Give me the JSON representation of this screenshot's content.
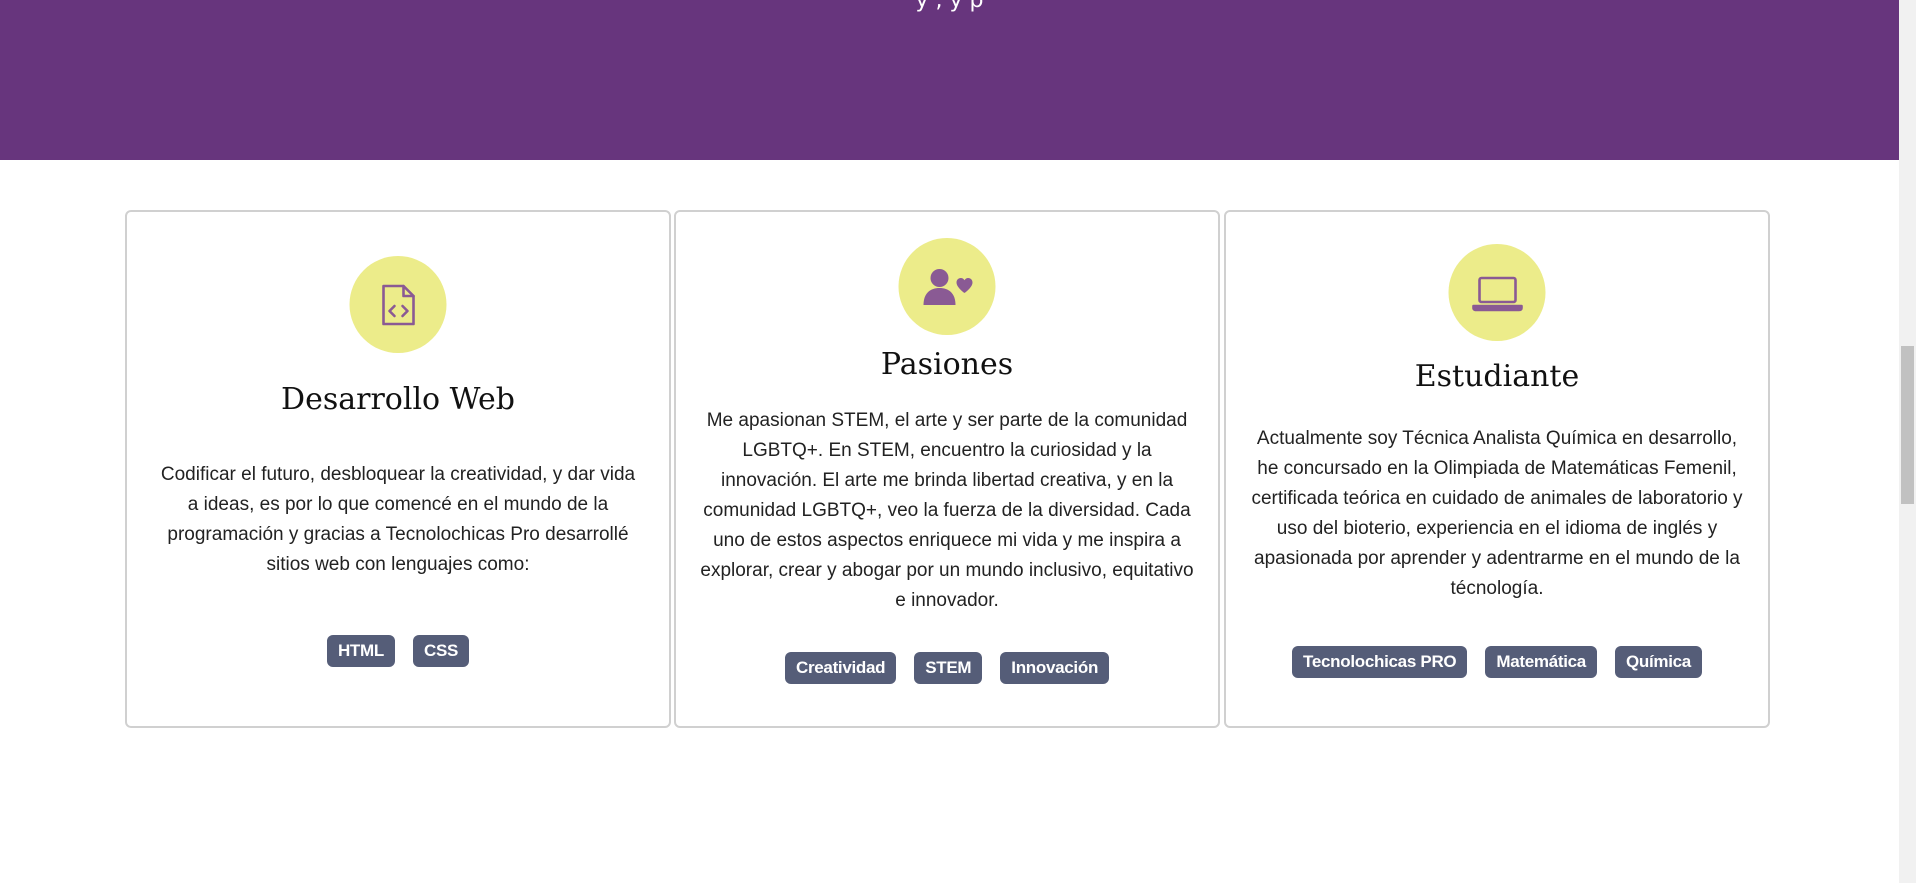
{
  "hero": {
    "partial_text": "y              ,     y         p"
  },
  "cards": [
    {
      "icon": "file-code-icon",
      "title": "Desarrollo Web",
      "text": "Codificar el futuro, desbloquear la creatividad, y dar vida a ideas, es por lo que comencé en el mundo de la programación y gracias a Tecnolochicas Pro desarrollé sitios web con lenguajes como:",
      "tags": [
        "HTML",
        "CSS"
      ]
    },
    {
      "icon": "user-heart-icon",
      "title": "Pasiones",
      "text": "Me apasionan STEM, el arte y ser parte de la comunidad LGBTQ+. En STEM, encuentro la curiosidad y la innovación. El arte me brinda libertad creativa, y en la comunidad LGBTQ+, veo la fuerza de la diversidad. Cada uno de estos aspectos enriquece mi vida y me inspira a explorar, crear y abogar por un mundo inclusivo, equitativo e innovador.",
      "tags": [
        "Creatividad",
        "STEM",
        "Innovación"
      ]
    },
    {
      "icon": "laptop-icon",
      "title": "Estudiante",
      "text": "Actualmente soy Técnica Analista Química en desarrollo, he concursado en la Olimpiada de Matemáticas Femenil, certificada teórica en cuidado de animales de laboratorio y uso del bioterio, experiencia en el idioma de inglés y apasionada por aprender y adentrarme en el mundo de la técnología.",
      "tags": [
        "Tecnolochicas PRO",
        "Matemática",
        "Química"
      ]
    }
  ],
  "colors": {
    "hero": "#67357d",
    "icon_circle": "#ecec8a",
    "icon_stroke": "#8a5a94",
    "tag": "#555d78"
  }
}
